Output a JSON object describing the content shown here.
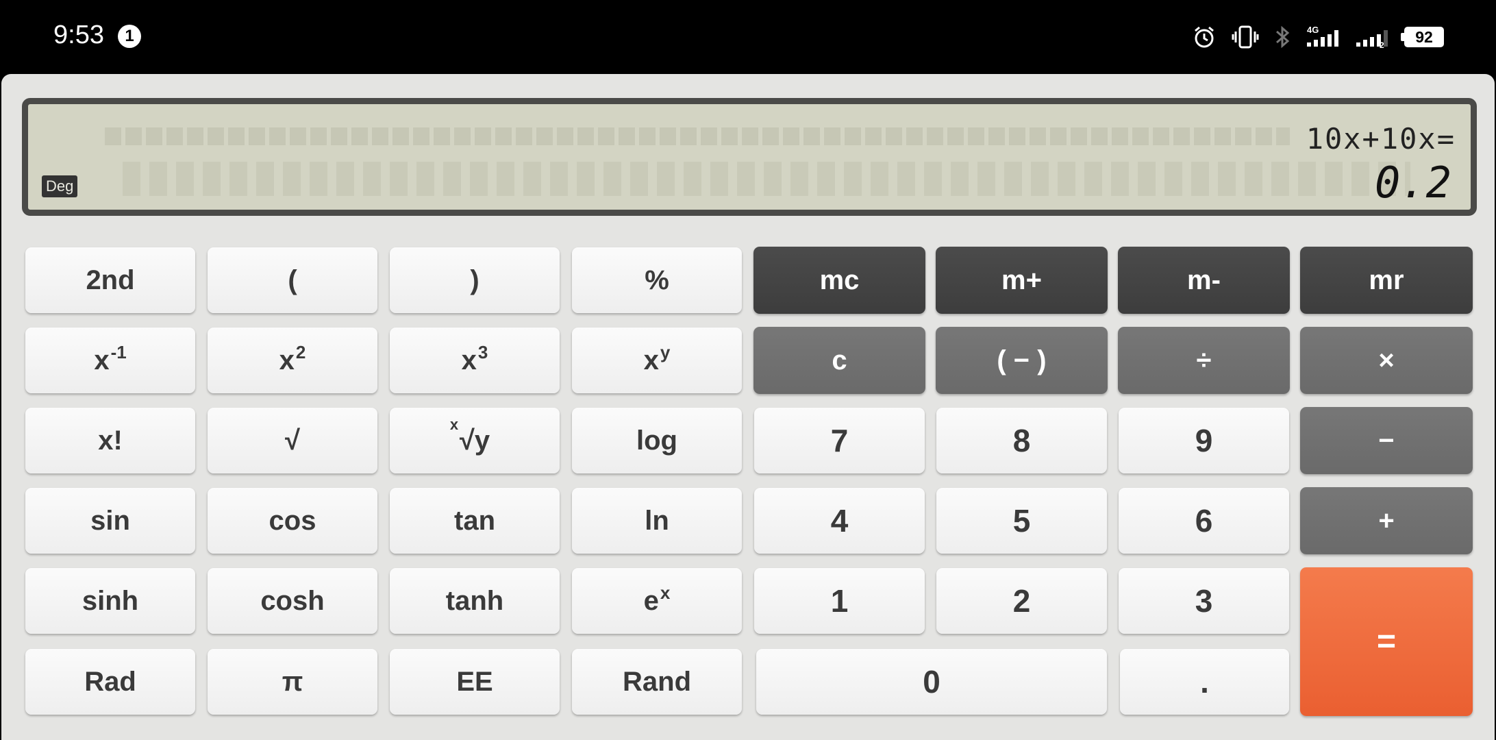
{
  "status": {
    "time": "9:53",
    "notification_count": "1",
    "network_label": "4G",
    "sim_label": "2",
    "battery": "92",
    "icons": [
      "alarm-icon",
      "vibrate-icon",
      "bluetooth-icon",
      "signal-icon",
      "signal-icon"
    ]
  },
  "display": {
    "expression": "10x+10x=",
    "result": "0.2",
    "mode": "Deg"
  },
  "keys": {
    "second": "2nd",
    "lparen": "(",
    "rparen": ")",
    "percent": "%",
    "mc": "mc",
    "mplus": "m+",
    "mminus": "m-",
    "mr": "mr",
    "inv_base": "x",
    "inv_exp": "-1",
    "sq_base": "x",
    "sq_exp": "2",
    "cube_base": "x",
    "cube_exp": "3",
    "pow_base": "x",
    "pow_exp": "y",
    "clear": "c",
    "negate": "( − )",
    "divide": "÷",
    "multiply": "×",
    "factorial": "x!",
    "sqrt": "√",
    "root_x": "x",
    "root_sym": "√y",
    "log": "log",
    "seven": "7",
    "eight": "8",
    "nine": "9",
    "minus": "−",
    "sin": "sin",
    "cos": "cos",
    "tan": "tan",
    "ln": "ln",
    "four": "4",
    "five": "5",
    "six": "6",
    "plus": "+",
    "sinh": "sinh",
    "cosh": "cosh",
    "tanh": "tanh",
    "exp_base": "e",
    "exp_exp": "x",
    "one": "1",
    "two": "2",
    "three": "3",
    "equals": "=",
    "rad": "Rad",
    "pi": "π",
    "ee": "EE",
    "rand": "Rand",
    "zero": "0",
    "dot": "."
  }
}
